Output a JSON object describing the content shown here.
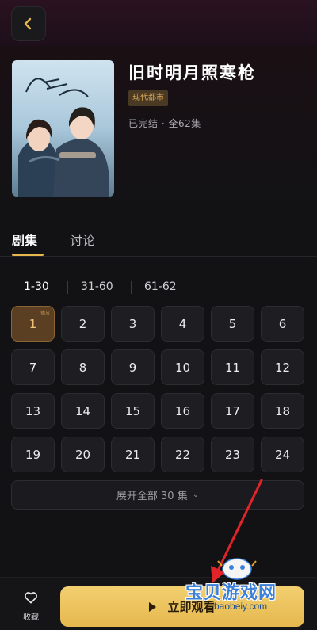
{
  "header": {
    "back_icon": "chevron-left-icon",
    "accent": "#e5b74d"
  },
  "show": {
    "title": "旧时明月照寒枪",
    "genre": "现代都市",
    "status": "已完结 · 全62集",
    "poster_caption": "旧时明月照寒枪"
  },
  "tabs": [
    {
      "label": "剧集",
      "active": true
    },
    {
      "label": "讨论",
      "active": false
    }
  ],
  "ranges": [
    {
      "label": "1-30",
      "active": true
    },
    {
      "label": "31-60",
      "active": false
    },
    {
      "label": "61-62",
      "active": false
    }
  ],
  "episodes": {
    "current": 1,
    "current_badge": "播放",
    "items": [
      "1",
      "2",
      "3",
      "4",
      "5",
      "6",
      "7",
      "8",
      "9",
      "10",
      "11",
      "12",
      "13",
      "14",
      "15",
      "16",
      "17",
      "18",
      "19",
      "20",
      "21",
      "22",
      "23",
      "24"
    ]
  },
  "expand": {
    "label": "展开全部 30 集",
    "icon": "chevron-down-icon"
  },
  "bottom": {
    "favorite_label": "收藏",
    "favorite_icon": "heart-icon",
    "play_label": "立即观看",
    "play_icon": "play-icon"
  },
  "watermark": {
    "text": "宝贝游戏网",
    "url": "baobeiy.com"
  }
}
